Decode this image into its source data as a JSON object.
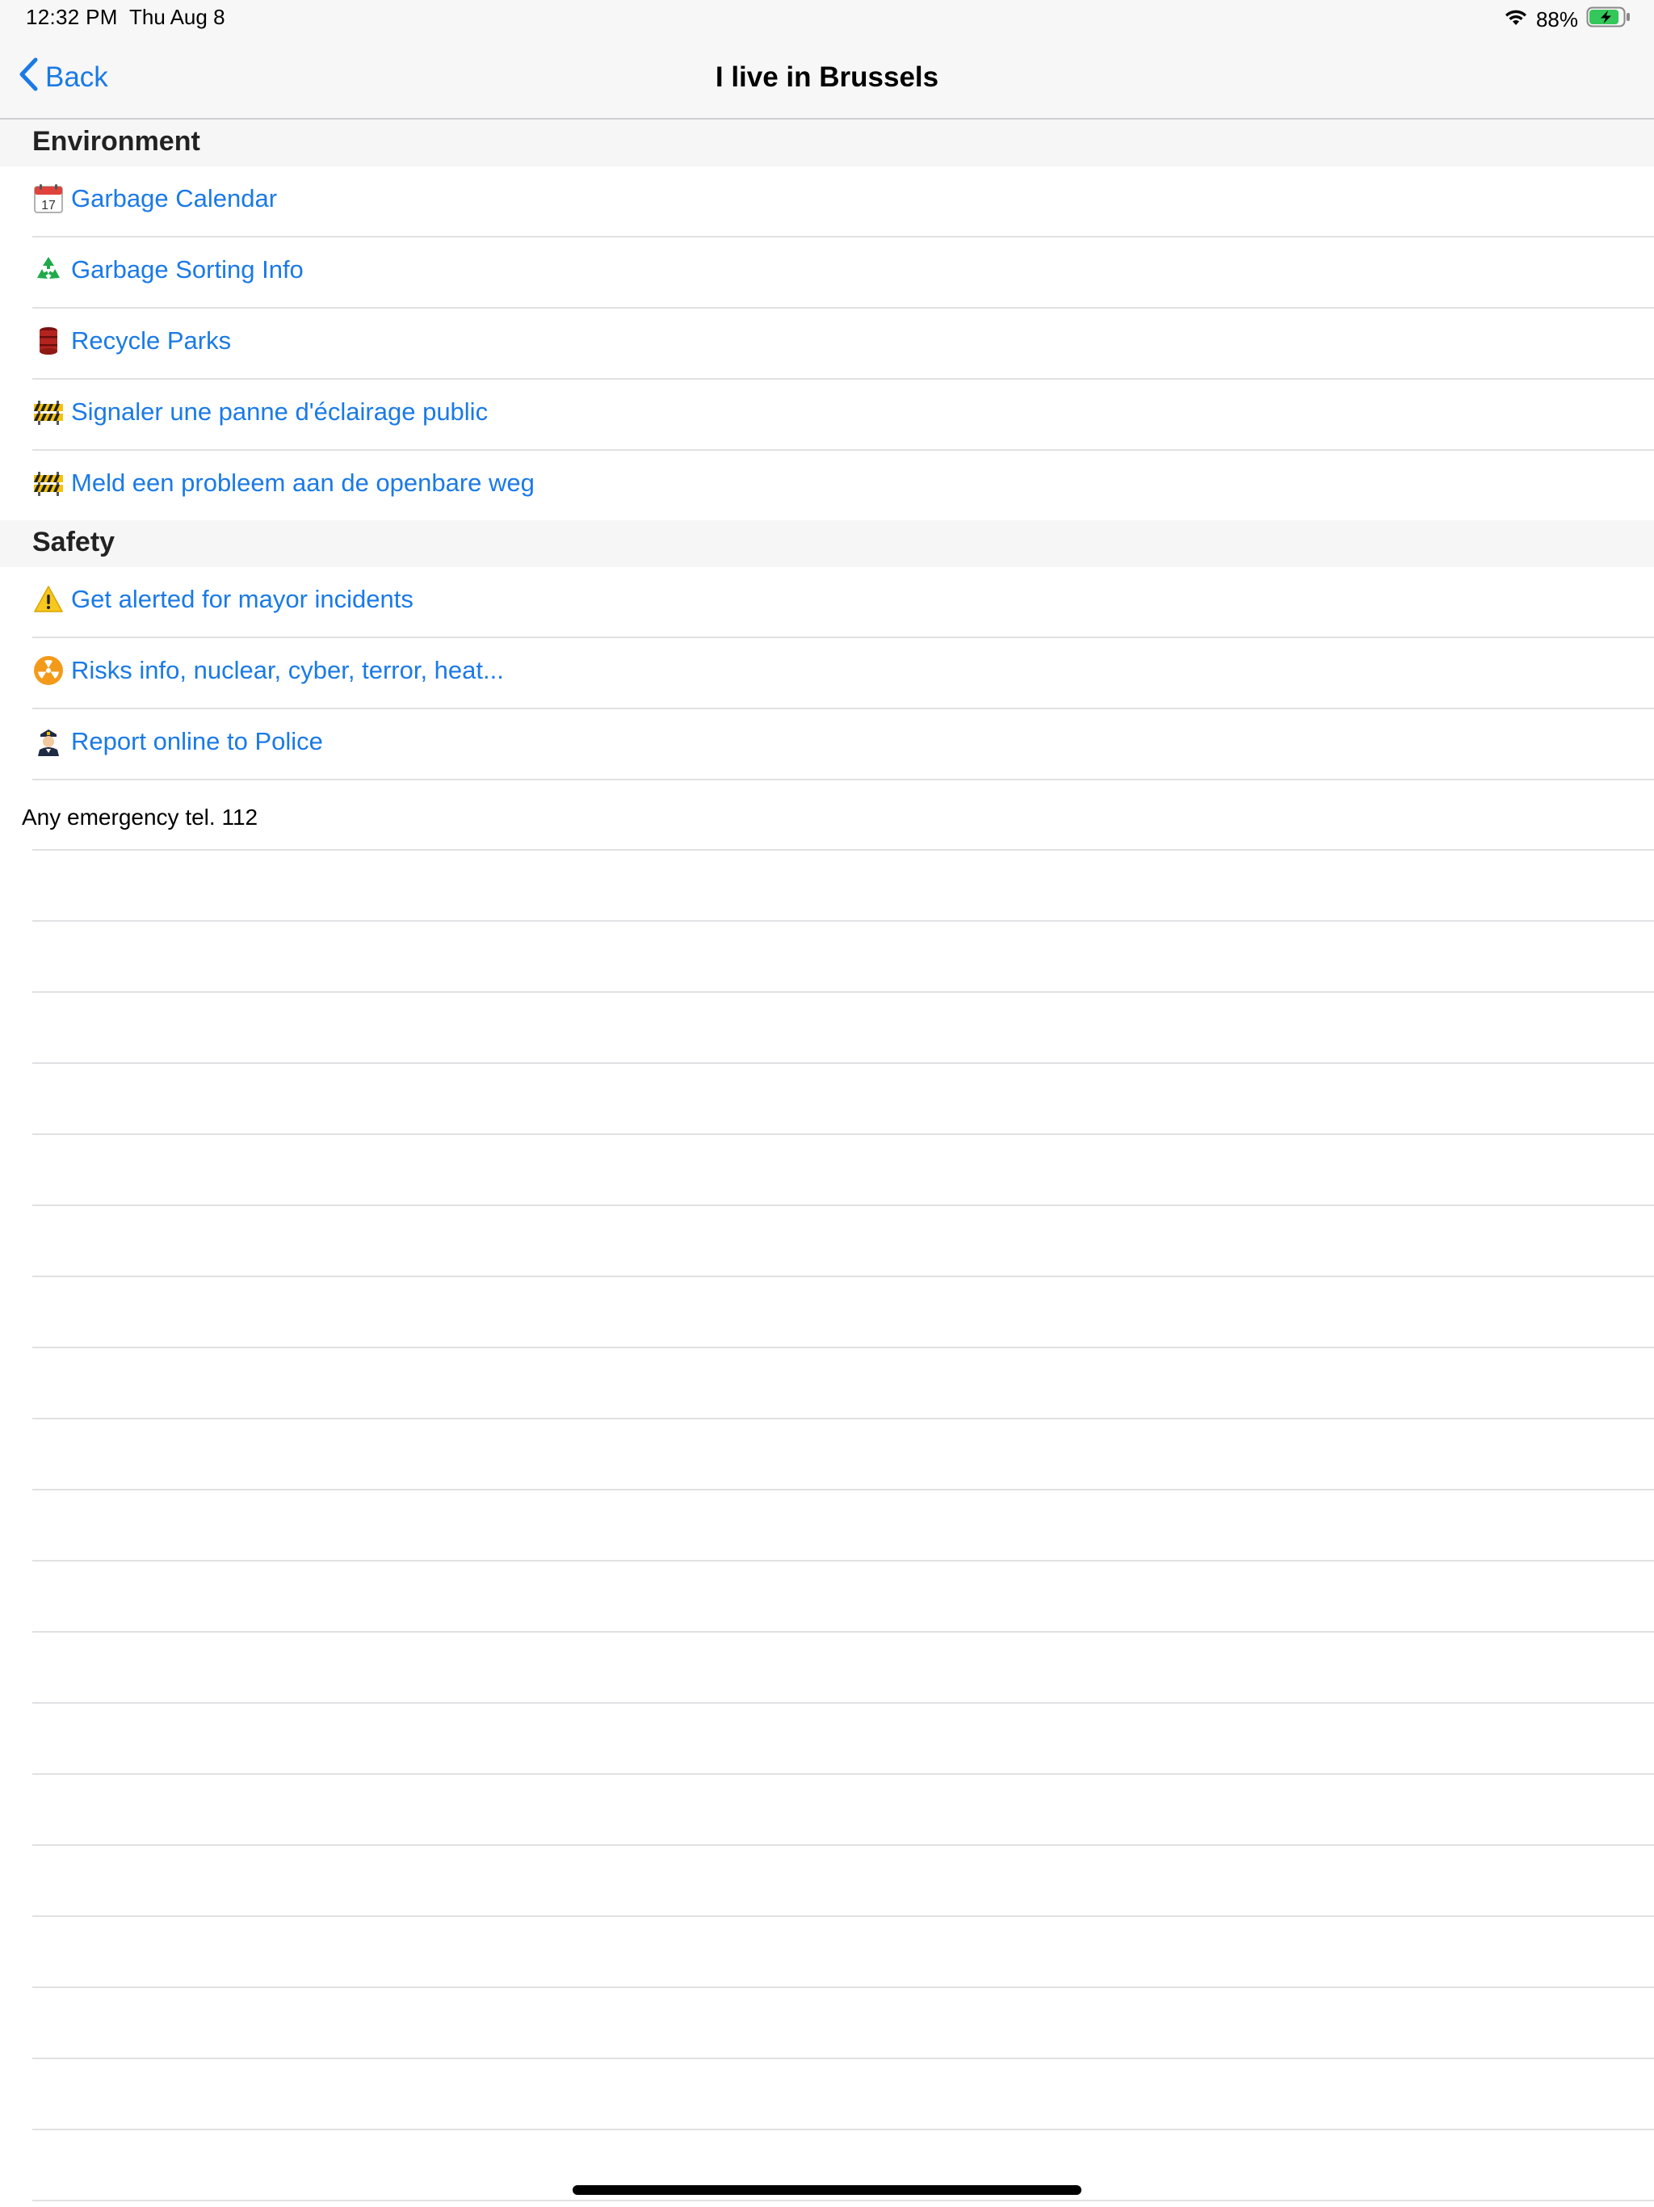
{
  "status_bar": {
    "time": "12:32 PM",
    "date": "Thu Aug 8",
    "battery_percent": "88%",
    "battery_level": 0.88,
    "icons": [
      "wifi-icon",
      "battery-charging-icon"
    ]
  },
  "nav": {
    "back_label": "Back",
    "title": "I live in Brussels"
  },
  "sections": [
    {
      "title": "Environment",
      "items": [
        {
          "icon": "calendar-icon",
          "label": "Garbage Calendar"
        },
        {
          "icon": "recycle-icon",
          "label": "Garbage Sorting Info"
        },
        {
          "icon": "barrel-icon",
          "label": "Recycle Parks"
        },
        {
          "icon": "construction-barrier-icon",
          "label": "Signaler une panne d'éclairage public"
        },
        {
          "icon": "construction-barrier-icon",
          "label": "Meld een probleem aan de openbare weg"
        }
      ]
    },
    {
      "title": "Safety",
      "items": [
        {
          "icon": "warning-icon",
          "label": "Get alerted for mayor incidents"
        },
        {
          "icon": "radioactive-icon",
          "label": "Risks info, nuclear, cyber, terror, heat..."
        },
        {
          "icon": "police-officer-icon",
          "label": "Report online to Police"
        }
      ]
    }
  ],
  "footer_note": "Any emergency tel. 112",
  "colors": {
    "link": "#1a7ae6",
    "bar_background": "#f7f7f7",
    "separator": "#e1e1e4"
  }
}
